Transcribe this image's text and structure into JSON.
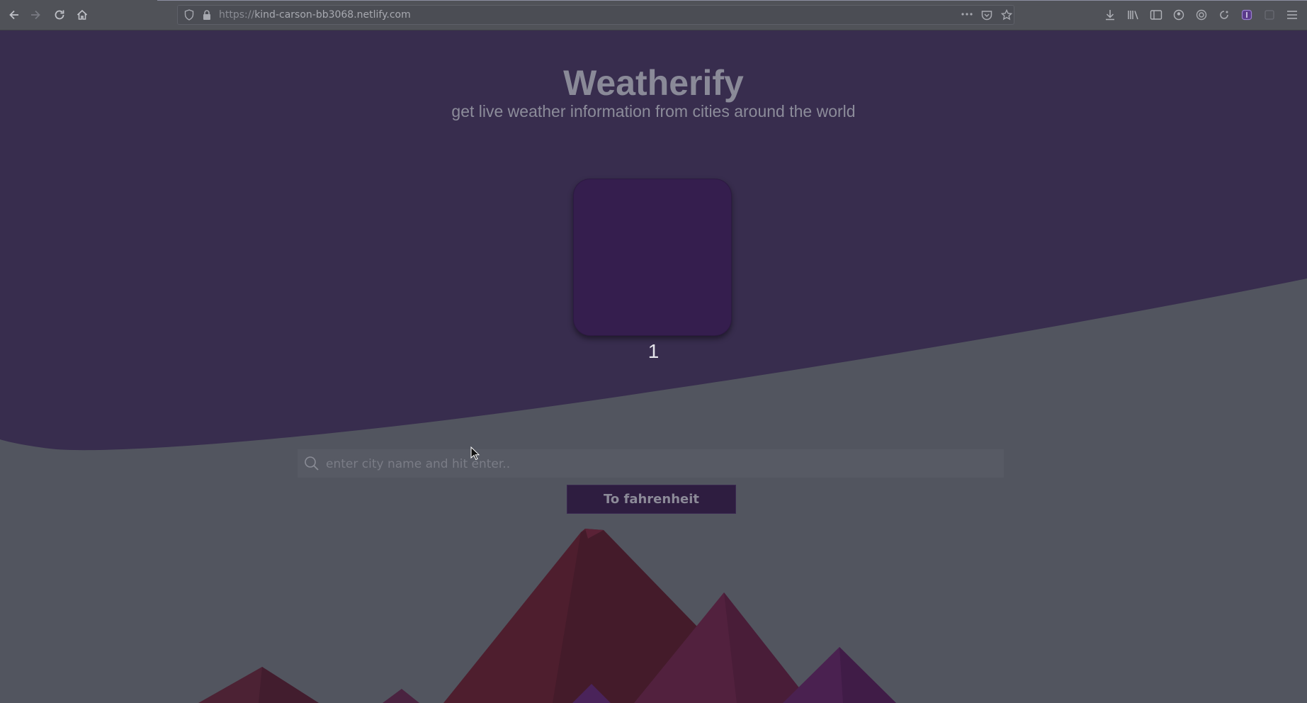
{
  "browser": {
    "url_prefix": "https://",
    "url_host": "kind-carson-bb3068.netlify.com",
    "icons": {
      "back": "arrow-left-icon",
      "forward": "arrow-right-icon",
      "reload": "reload-icon",
      "home": "home-icon",
      "tracking": "shield-icon",
      "lock": "lock-icon",
      "page_actions": "more-icon",
      "pocket": "pocket-icon",
      "bookmark": "star-icon",
      "downloads": "download-icon",
      "library": "library-icon",
      "sidebar": "sidebar-icon",
      "menu": "hamburger-menu-icon"
    }
  },
  "app": {
    "title": "Weatherify",
    "subtitle": "get live weather information from cities around the world",
    "card_counter": "1",
    "search_placeholder": "enter city name and hit enter..",
    "search_value": "",
    "unit_button_label": "To fahrenheit"
  },
  "colors": {
    "wave": "#382d4e",
    "background": "#52555f",
    "card": "#351e4e",
    "button": "#2e1d40"
  }
}
